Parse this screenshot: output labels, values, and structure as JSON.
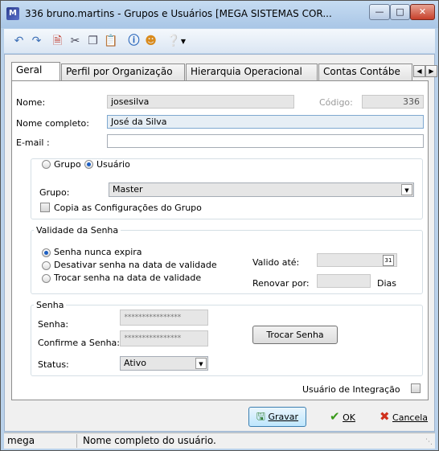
{
  "window": {
    "title": "336 bruno.martins -  Grupos e Usuários [MEGA SISTEMAS COR...",
    "app_icon": "mega-logo-icon",
    "controls": [
      "minimize",
      "maximize",
      "close"
    ]
  },
  "toolbar": {
    "icons": [
      "undo-icon",
      "redo-icon",
      "new-document-icon",
      "cut-icon",
      "copy-icon",
      "paste-icon",
      "info-icon",
      "user-group-icon",
      "help-icon",
      "dropdown-arrow-icon"
    ]
  },
  "tabs": {
    "items": [
      "Geral",
      "Perfil por Organização",
      "Hierarquia Operacional",
      "Contas Contábe"
    ],
    "active": "Geral"
  },
  "form": {
    "nome_label": "Nome:",
    "nome_value": "josesilva",
    "codigo_label": "Código:",
    "codigo_value": "336",
    "nome_completo_label": "Nome completo:",
    "nome_completo_value": "José da Silva",
    "email_label": "E-mail :",
    "email_value": ""
  },
  "tipo": {
    "grupo_label": "Grupo",
    "usuario_label": "Usuário",
    "selected": "Usuário",
    "grupo_field_label": "Grupo:",
    "grupo_field_value": "Master",
    "copia_label": "Copia as Configurações do Grupo",
    "copia_checked": false
  },
  "validade": {
    "legend": "Validade da Senha",
    "options": [
      "Senha nunca expira",
      "Desativar senha na data de validade",
      "Trocar senha na data de validade"
    ],
    "selected": "Senha nunca expira",
    "valido_ate_label": "Valido até:",
    "renovar_label": "Renovar por:",
    "dias_label": "Dias"
  },
  "senha": {
    "legend": "Senha",
    "senha_label": "Senha:",
    "senha_mask": "****************",
    "confirme_label": "Confirme a Senha:",
    "confirme_mask": "****************",
    "trocar_button": "Trocar Senha",
    "status_label": "Status:",
    "status_value": "Ativo"
  },
  "integracao": {
    "label": "Usuário de Integração",
    "checked": false
  },
  "buttons": {
    "gravar": "Gravar",
    "ok": "OK",
    "cancela": "Cancela"
  },
  "statusbar": {
    "user": "mega",
    "hint": "Nome completo do usuário."
  },
  "colors": {
    "titlebar": "#b9d1ea",
    "close_button": "#c7402b",
    "ok_check": "#3a9a1a",
    "cancel_x": "#d0301c"
  }
}
